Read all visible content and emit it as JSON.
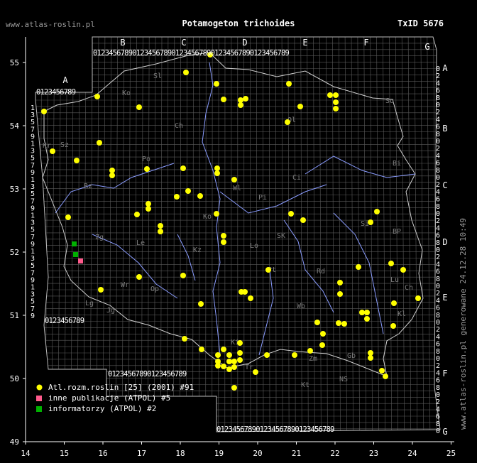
{
  "header": {
    "title": "Potamogeton trichoides",
    "site": "www.atlas-roslin.pl",
    "txid": "TxID 5676"
  },
  "side_note": "www.atlas-roslin.pl generowane 24.12.28 10:49",
  "axes": {
    "x_ticks": [
      "14",
      "15",
      "16",
      "17",
      "18",
      "19",
      "20",
      "21",
      "22",
      "23",
      "24",
      "25"
    ],
    "y_ticks": [
      "55",
      "54",
      "53",
      "52",
      "51",
      "50",
      "49"
    ]
  },
  "atpol_columns": [
    "A",
    "B",
    "C",
    "D",
    "E",
    "F",
    "G"
  ],
  "atpol_rows": [
    "A",
    "B",
    "C",
    "D",
    "E",
    "F",
    "G"
  ],
  "grid_digits": "0123456789",
  "region_labels": [
    "Ko",
    "Sl",
    "Ch",
    "Ol",
    "Su",
    "Sz",
    "Bi",
    "Po",
    "Ci",
    "Wl",
    "Pi",
    "Zg",
    "Le",
    "Ko",
    "Kz",
    "Lo",
    "SK",
    "Si",
    "BP",
    "Pt",
    "Rd",
    "Lu",
    "Ch",
    "Op",
    "Wr",
    "Lg",
    "Jg",
    "Wb",
    "Kl",
    "Zm",
    "Ki",
    "Tr",
    "Kt",
    "Gb",
    "NS",
    "Rz",
    "Kr"
  ],
  "legend": [
    {
      "label": "Atl.rozm.roslin [25] (2001) #91",
      "symbol": "circle",
      "color": "#ffff00"
    },
    {
      "label": "inne publikacje (ATPOL) #5",
      "symbol": "square",
      "color": "#ff5a8c"
    },
    {
      "label": "informatorzy (ATPOL) #2",
      "symbol": "square",
      "color": "#00b000"
    }
  ],
  "colors": {
    "point": "#ffff00",
    "grid": "#5a5a5a",
    "river": "#8a9cff",
    "border": "#cfcfcf"
  }
}
